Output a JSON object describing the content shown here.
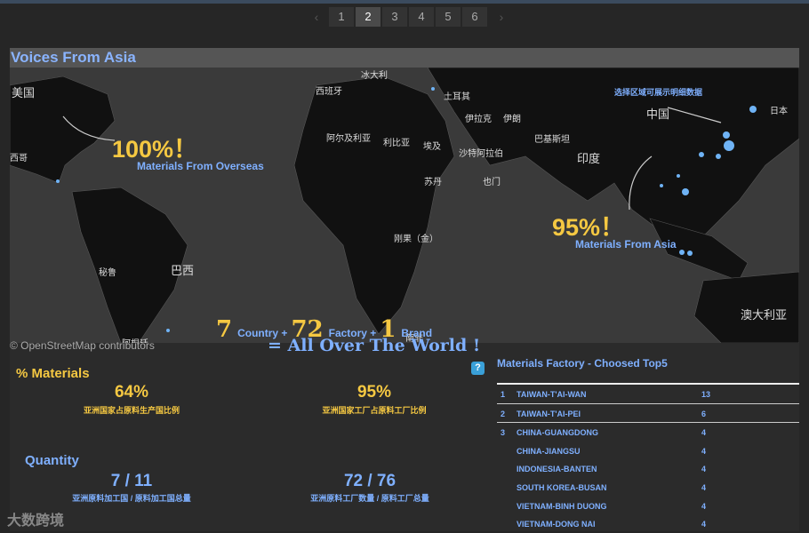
{
  "pagination": {
    "prev": "‹",
    "next": "›",
    "pages": [
      "1",
      "2",
      "3",
      "4",
      "5",
      "6"
    ],
    "current": "2"
  },
  "panel": {
    "title": "Voices From Asia"
  },
  "map": {
    "labels": {
      "usa": "美国",
      "mexico": "西哥",
      "spain": "西班牙",
      "iceland": "冰大利",
      "turkey": "土耳其",
      "iraq": "伊拉克",
      "iran": "伊朗",
      "algeria": "阿尔及利亚",
      "libya": "利比亚",
      "egypt": "埃及",
      "saudi": "沙特阿拉伯",
      "pakistan": "巴基斯坦",
      "india": "印度",
      "china": "中国",
      "japan": "日本",
      "sudan": "苏丹",
      "yemen": "也门",
      "congo": "刚果（金）",
      "brazil": "巴西",
      "peru": "秘鲁",
      "argentina": "阿根廷",
      "southafrica": "南非",
      "australia": "澳大利亚"
    },
    "select_tip": "选择区域可展示明细数据",
    "overseas_pct": "100%！",
    "overseas_label": "Materials From Overseas",
    "asia_pct": "95%！",
    "asia_label": "Materials From Asia",
    "attribution": "© OpenStreetMap contributors",
    "summary": {
      "country_num": "7",
      "country_label": "Country +",
      "factory_num": "72",
      "factory_label": "Factory +",
      "brand_num": "1",
      "brand_label": "Brand"
    },
    "tagline": "= All  Over The World !",
    "colors": {
      "accent": "#7fb0ff",
      "highlight": "#f5c842",
      "dot": "#6fb3f5"
    }
  },
  "materials": {
    "title": "% Materials",
    "left_value": "64%",
    "left_label": "亚洲国家占原料生产国比例",
    "right_value": "95%",
    "right_label": "亚洲国家工厂占原料工厂比例"
  },
  "quantity": {
    "title": "Quantity",
    "left_value": "7 / 11",
    "left_label": "亚洲原料加工国 / 原料加工国总量",
    "right_value": "72 / 76",
    "right_label": "亚洲原料工厂数量 / 原料工厂总量"
  },
  "help_icon": "?",
  "factory": {
    "title": "Materials Factory  - Choosed Top5",
    "rows": [
      {
        "rank": "1",
        "name": "TAIWAN-T'AI-WAN",
        "count": "13"
      },
      {
        "rank": "2",
        "name": "TAIWAN-T'AI-PEI",
        "count": "6"
      },
      {
        "rank": "3",
        "name": "CHINA-GUANGDONG",
        "count": "4"
      },
      {
        "rank": "",
        "name": "CHINA-JIANGSU",
        "count": "4"
      },
      {
        "rank": "",
        "name": "INDONESIA-BANTEN",
        "count": "4"
      },
      {
        "rank": "",
        "name": "SOUTH KOREA-BUSAN",
        "count": "4"
      },
      {
        "rank": "",
        "name": "VIETNAM-BINH DUONG",
        "count": "4"
      },
      {
        "rank": "",
        "name": "VIETNAM-DONG NAI",
        "count": "4"
      }
    ]
  },
  "watermark": "大数跨境"
}
